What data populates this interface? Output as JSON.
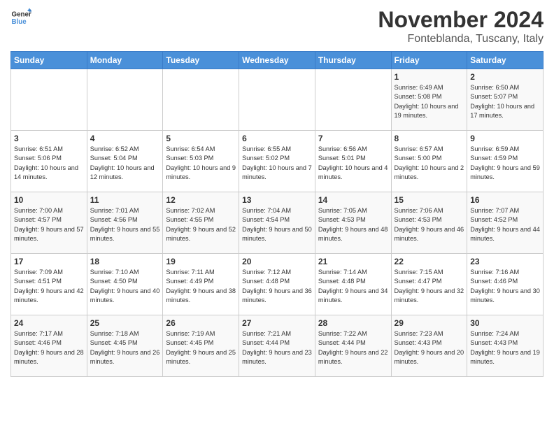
{
  "logo": {
    "general": "General",
    "blue": "Blue"
  },
  "title": "November 2024",
  "subtitle": "Fonteblanda, Tuscany, Italy",
  "days_of_week": [
    "Sunday",
    "Monday",
    "Tuesday",
    "Wednesday",
    "Thursday",
    "Friday",
    "Saturday"
  ],
  "weeks": [
    [
      {
        "day": "",
        "info": ""
      },
      {
        "day": "",
        "info": ""
      },
      {
        "day": "",
        "info": ""
      },
      {
        "day": "",
        "info": ""
      },
      {
        "day": "",
        "info": ""
      },
      {
        "day": "1",
        "info": "Sunrise: 6:49 AM\nSunset: 5:08 PM\nDaylight: 10 hours and 19 minutes."
      },
      {
        "day": "2",
        "info": "Sunrise: 6:50 AM\nSunset: 5:07 PM\nDaylight: 10 hours and 17 minutes."
      }
    ],
    [
      {
        "day": "3",
        "info": "Sunrise: 6:51 AM\nSunset: 5:06 PM\nDaylight: 10 hours and 14 minutes."
      },
      {
        "day": "4",
        "info": "Sunrise: 6:52 AM\nSunset: 5:04 PM\nDaylight: 10 hours and 12 minutes."
      },
      {
        "day": "5",
        "info": "Sunrise: 6:54 AM\nSunset: 5:03 PM\nDaylight: 10 hours and 9 minutes."
      },
      {
        "day": "6",
        "info": "Sunrise: 6:55 AM\nSunset: 5:02 PM\nDaylight: 10 hours and 7 minutes."
      },
      {
        "day": "7",
        "info": "Sunrise: 6:56 AM\nSunset: 5:01 PM\nDaylight: 10 hours and 4 minutes."
      },
      {
        "day": "8",
        "info": "Sunrise: 6:57 AM\nSunset: 5:00 PM\nDaylight: 10 hours and 2 minutes."
      },
      {
        "day": "9",
        "info": "Sunrise: 6:59 AM\nSunset: 4:59 PM\nDaylight: 9 hours and 59 minutes."
      }
    ],
    [
      {
        "day": "10",
        "info": "Sunrise: 7:00 AM\nSunset: 4:57 PM\nDaylight: 9 hours and 57 minutes."
      },
      {
        "day": "11",
        "info": "Sunrise: 7:01 AM\nSunset: 4:56 PM\nDaylight: 9 hours and 55 minutes."
      },
      {
        "day": "12",
        "info": "Sunrise: 7:02 AM\nSunset: 4:55 PM\nDaylight: 9 hours and 52 minutes."
      },
      {
        "day": "13",
        "info": "Sunrise: 7:04 AM\nSunset: 4:54 PM\nDaylight: 9 hours and 50 minutes."
      },
      {
        "day": "14",
        "info": "Sunrise: 7:05 AM\nSunset: 4:53 PM\nDaylight: 9 hours and 48 minutes."
      },
      {
        "day": "15",
        "info": "Sunrise: 7:06 AM\nSunset: 4:53 PM\nDaylight: 9 hours and 46 minutes."
      },
      {
        "day": "16",
        "info": "Sunrise: 7:07 AM\nSunset: 4:52 PM\nDaylight: 9 hours and 44 minutes."
      }
    ],
    [
      {
        "day": "17",
        "info": "Sunrise: 7:09 AM\nSunset: 4:51 PM\nDaylight: 9 hours and 42 minutes."
      },
      {
        "day": "18",
        "info": "Sunrise: 7:10 AM\nSunset: 4:50 PM\nDaylight: 9 hours and 40 minutes."
      },
      {
        "day": "19",
        "info": "Sunrise: 7:11 AM\nSunset: 4:49 PM\nDaylight: 9 hours and 38 minutes."
      },
      {
        "day": "20",
        "info": "Sunrise: 7:12 AM\nSunset: 4:48 PM\nDaylight: 9 hours and 36 minutes."
      },
      {
        "day": "21",
        "info": "Sunrise: 7:14 AM\nSunset: 4:48 PM\nDaylight: 9 hours and 34 minutes."
      },
      {
        "day": "22",
        "info": "Sunrise: 7:15 AM\nSunset: 4:47 PM\nDaylight: 9 hours and 32 minutes."
      },
      {
        "day": "23",
        "info": "Sunrise: 7:16 AM\nSunset: 4:46 PM\nDaylight: 9 hours and 30 minutes."
      }
    ],
    [
      {
        "day": "24",
        "info": "Sunrise: 7:17 AM\nSunset: 4:46 PM\nDaylight: 9 hours and 28 minutes."
      },
      {
        "day": "25",
        "info": "Sunrise: 7:18 AM\nSunset: 4:45 PM\nDaylight: 9 hours and 26 minutes."
      },
      {
        "day": "26",
        "info": "Sunrise: 7:19 AM\nSunset: 4:45 PM\nDaylight: 9 hours and 25 minutes."
      },
      {
        "day": "27",
        "info": "Sunrise: 7:21 AM\nSunset: 4:44 PM\nDaylight: 9 hours and 23 minutes."
      },
      {
        "day": "28",
        "info": "Sunrise: 7:22 AM\nSunset: 4:44 PM\nDaylight: 9 hours and 22 minutes."
      },
      {
        "day": "29",
        "info": "Sunrise: 7:23 AM\nSunset: 4:43 PM\nDaylight: 9 hours and 20 minutes."
      },
      {
        "day": "30",
        "info": "Sunrise: 7:24 AM\nSunset: 4:43 PM\nDaylight: 9 hours and 19 minutes."
      }
    ]
  ]
}
